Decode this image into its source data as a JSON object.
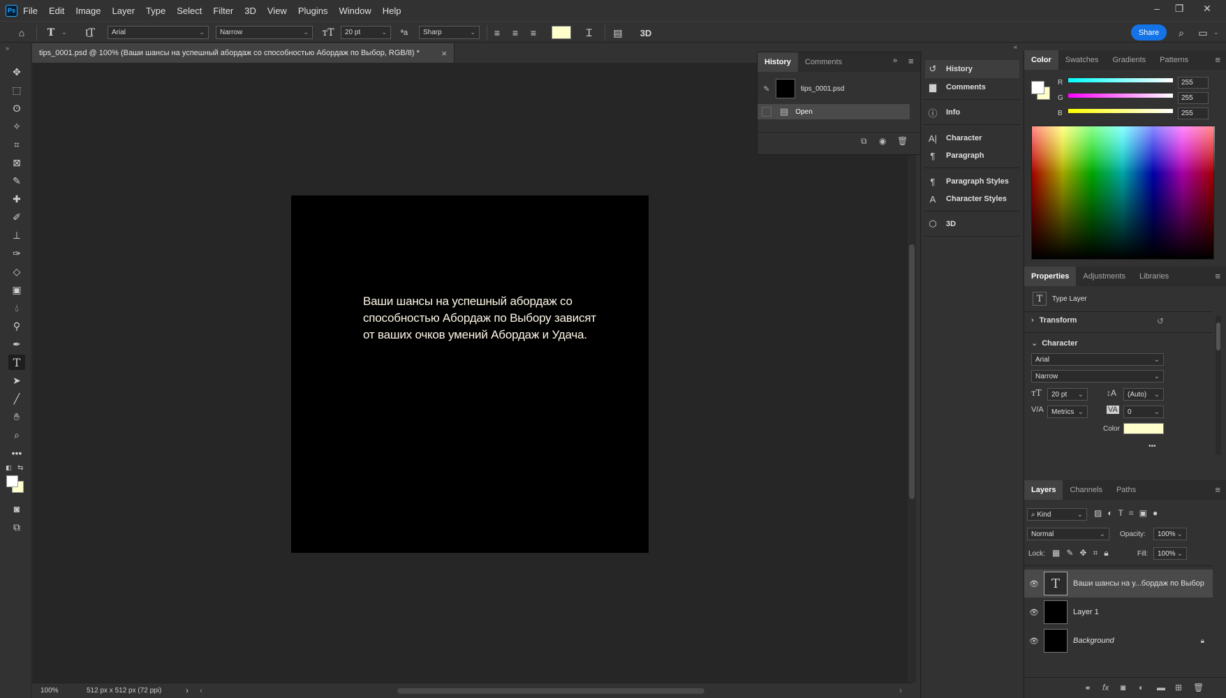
{
  "app": {
    "logo": "Ps"
  },
  "menu": [
    "File",
    "Edit",
    "Image",
    "Layer",
    "Type",
    "Select",
    "Filter",
    "3D",
    "View",
    "Plugins",
    "Window",
    "Help"
  ],
  "window_controls": {
    "minimize": "–",
    "restore": "❐",
    "close": "✕"
  },
  "options_bar": {
    "font_family": "Arial",
    "font_style": "Narrow",
    "font_size": "20 pt",
    "antialias": "Sharp",
    "text_color": "#ffffcc",
    "btn_3d": "3D",
    "share_label": "Share"
  },
  "document": {
    "tab_title": "tips_0001.psd @ 100% (Ваши шансы на успешный абордаж со способностью Абордаж по Выбор, RGB/8) *",
    "close": "×",
    "canvas_text": "Ваши шансы на успешный абордаж со способностью Абордаж по Выбору зависят от ваших очков умений Абордаж и Удача.",
    "zoom": "100%",
    "doc_info": "512 px x 512 px (72 ppi)"
  },
  "history_panel": {
    "tabs": [
      "History",
      "Comments"
    ],
    "snapshot_name": "tips_0001.psd",
    "states": [
      "Open"
    ]
  },
  "dock": {
    "items": [
      "History",
      "Comments",
      "Info",
      "Character",
      "Paragraph",
      "Paragraph Styles",
      "Character Styles",
      "3D"
    ]
  },
  "color_panel": {
    "tabs": [
      "Color",
      "Swatches",
      "Gradients",
      "Patterns"
    ],
    "channels": [
      {
        "label": "R",
        "value": "255"
      },
      {
        "label": "G",
        "value": "255"
      },
      {
        "label": "B",
        "value": "255"
      }
    ],
    "foreground": "#ffffff",
    "background": "#ffffcc"
  },
  "properties_panel": {
    "tabs": [
      "Properties",
      "Adjustments",
      "Libraries"
    ],
    "layer_type": "Type Layer",
    "transform": "Transform",
    "character": "Character",
    "font_family": "Arial",
    "font_style": "Narrow",
    "font_size": "20 pt",
    "leading": "(Auto)",
    "kerning": "Metrics",
    "tracking": "0",
    "color_label": "Color",
    "more": "•••"
  },
  "layers_panel": {
    "tabs": [
      "Layers",
      "Channels",
      "Paths"
    ],
    "filter": "Kind",
    "blend_mode": "Normal",
    "opacity_label": "Opacity:",
    "opacity": "100%",
    "lock_label": "Lock:",
    "fill_label": "Fill:",
    "fill": "100%",
    "layers": [
      {
        "name": "Ваши шансы на у...бордаж по Выбор",
        "type": "text"
      },
      {
        "name": "Layer 1",
        "type": "pixel"
      },
      {
        "name": "Background",
        "type": "background"
      }
    ]
  }
}
